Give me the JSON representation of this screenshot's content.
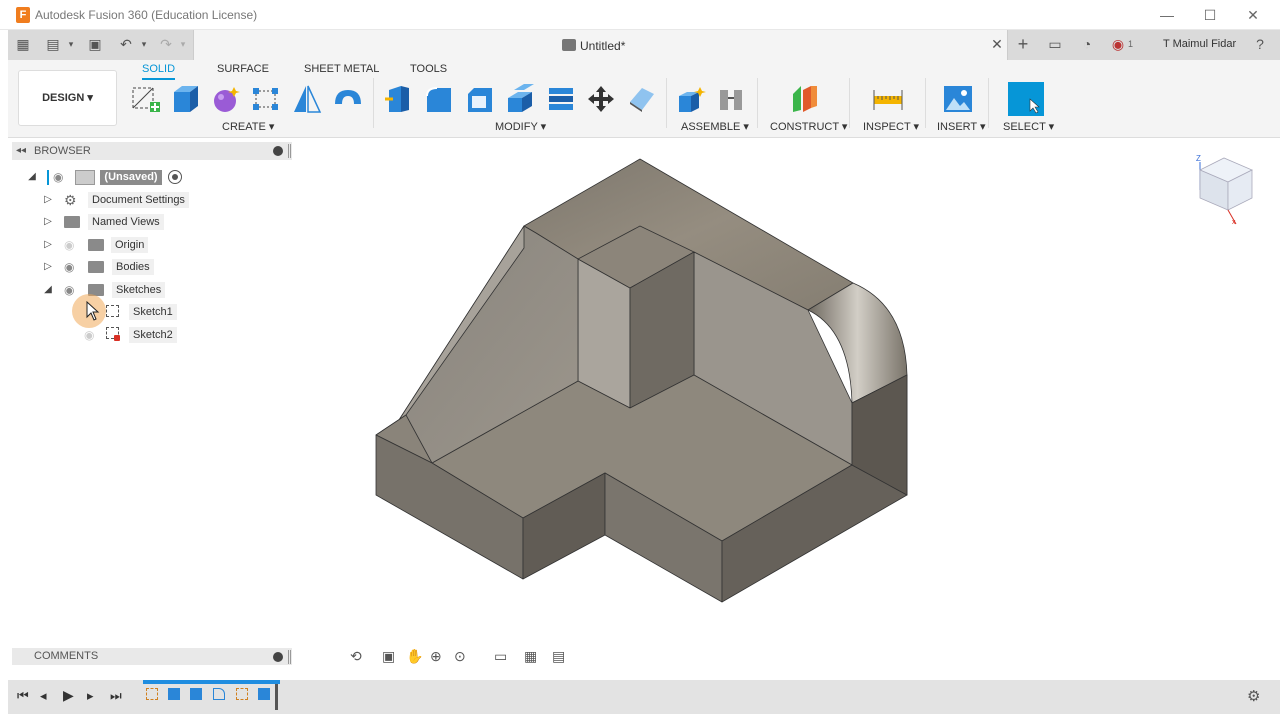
{
  "window": {
    "title": "Autodesk Fusion 360 (Education License)",
    "logo_letter": "F",
    "min": "—",
    "max": "☐",
    "close": "✕"
  },
  "document": {
    "title": "Untitled*",
    "user": "T Maimul Fidar",
    "notifications": "1"
  },
  "workspace": {
    "label": "DESIGN ▾"
  },
  "tabs": [
    "SOLID",
    "SURFACE",
    "SHEET METAL",
    "TOOLS"
  ],
  "groups": {
    "create": "CREATE ▾",
    "modify": "MODIFY ▾",
    "assemble": "ASSEMBLE ▾",
    "construct": "CONSTRUCT ▾",
    "inspect": "INSPECT ▾",
    "insert": "INSERT ▾",
    "select": "SELECT ▾"
  },
  "browser": {
    "title": "BROWSER",
    "root": "(Unsaved)",
    "items": [
      "Document Settings",
      "Named Views",
      "Origin",
      "Bodies",
      "Sketches",
      "Sketch1",
      "Sketch2"
    ]
  },
  "comments": {
    "title": "COMMENTS"
  },
  "viewcube": {
    "axis": "Z"
  },
  "colors": {
    "accent": "#0696d7",
    "timeline": "#1f8de0",
    "model_top": "#8d8577",
    "model_side": "#6a655c"
  }
}
